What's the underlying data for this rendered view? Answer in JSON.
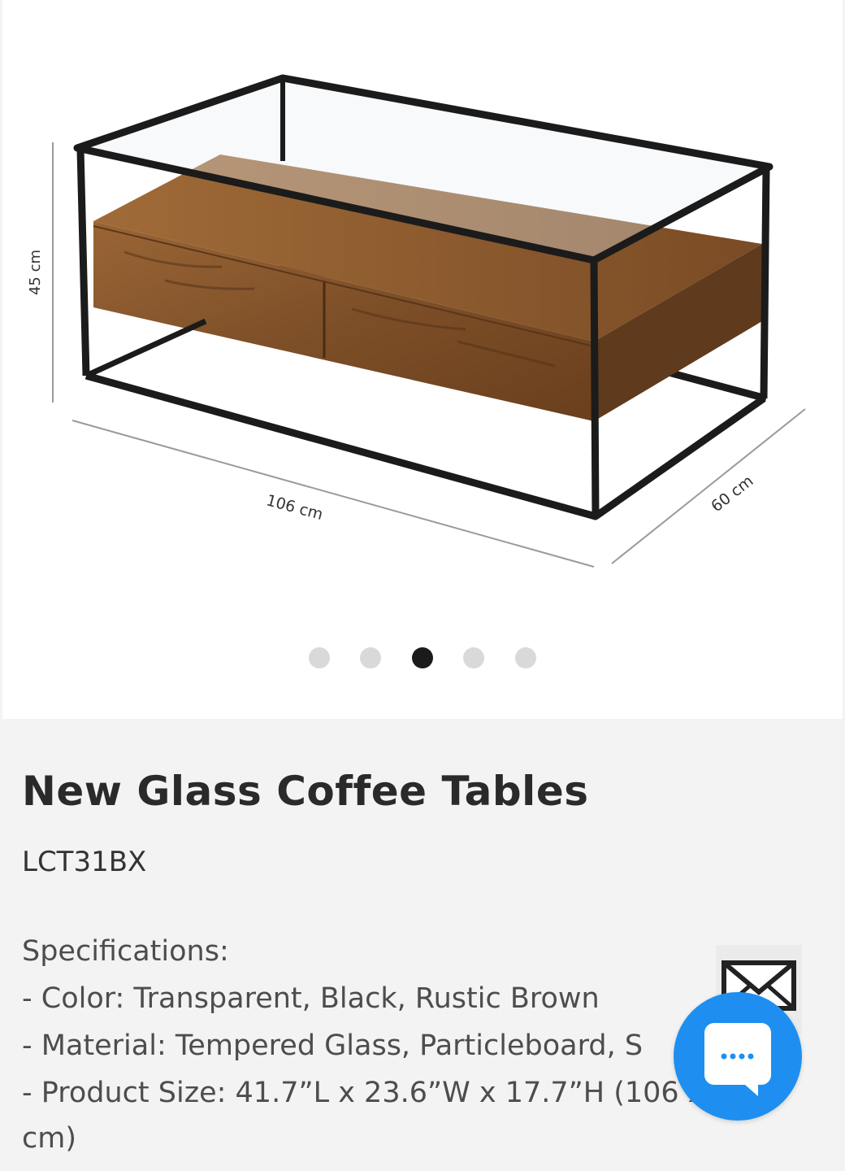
{
  "gallery": {
    "dimensions": {
      "height": "45 cm",
      "length": "106 cm",
      "depth": "60 cm"
    },
    "slides": 5,
    "active_slide": 3
  },
  "product": {
    "title": "New Glass Coffee Tables",
    "sku": "LCT31BX",
    "specs_heading": "Specifications:",
    "specs": [
      "- Color: Transparent, Black, Rustic Brown",
      "- Material: Tempered Glass, Particleboard, S",
      "- Product Size: 41.7”L x 23.6”W x 17.7”H (106 x 60",
      "cm)"
    ]
  },
  "colors": {
    "accent": "#1e8ff0",
    "wood": "#8a5a30",
    "frame": "#1b1b1b"
  }
}
